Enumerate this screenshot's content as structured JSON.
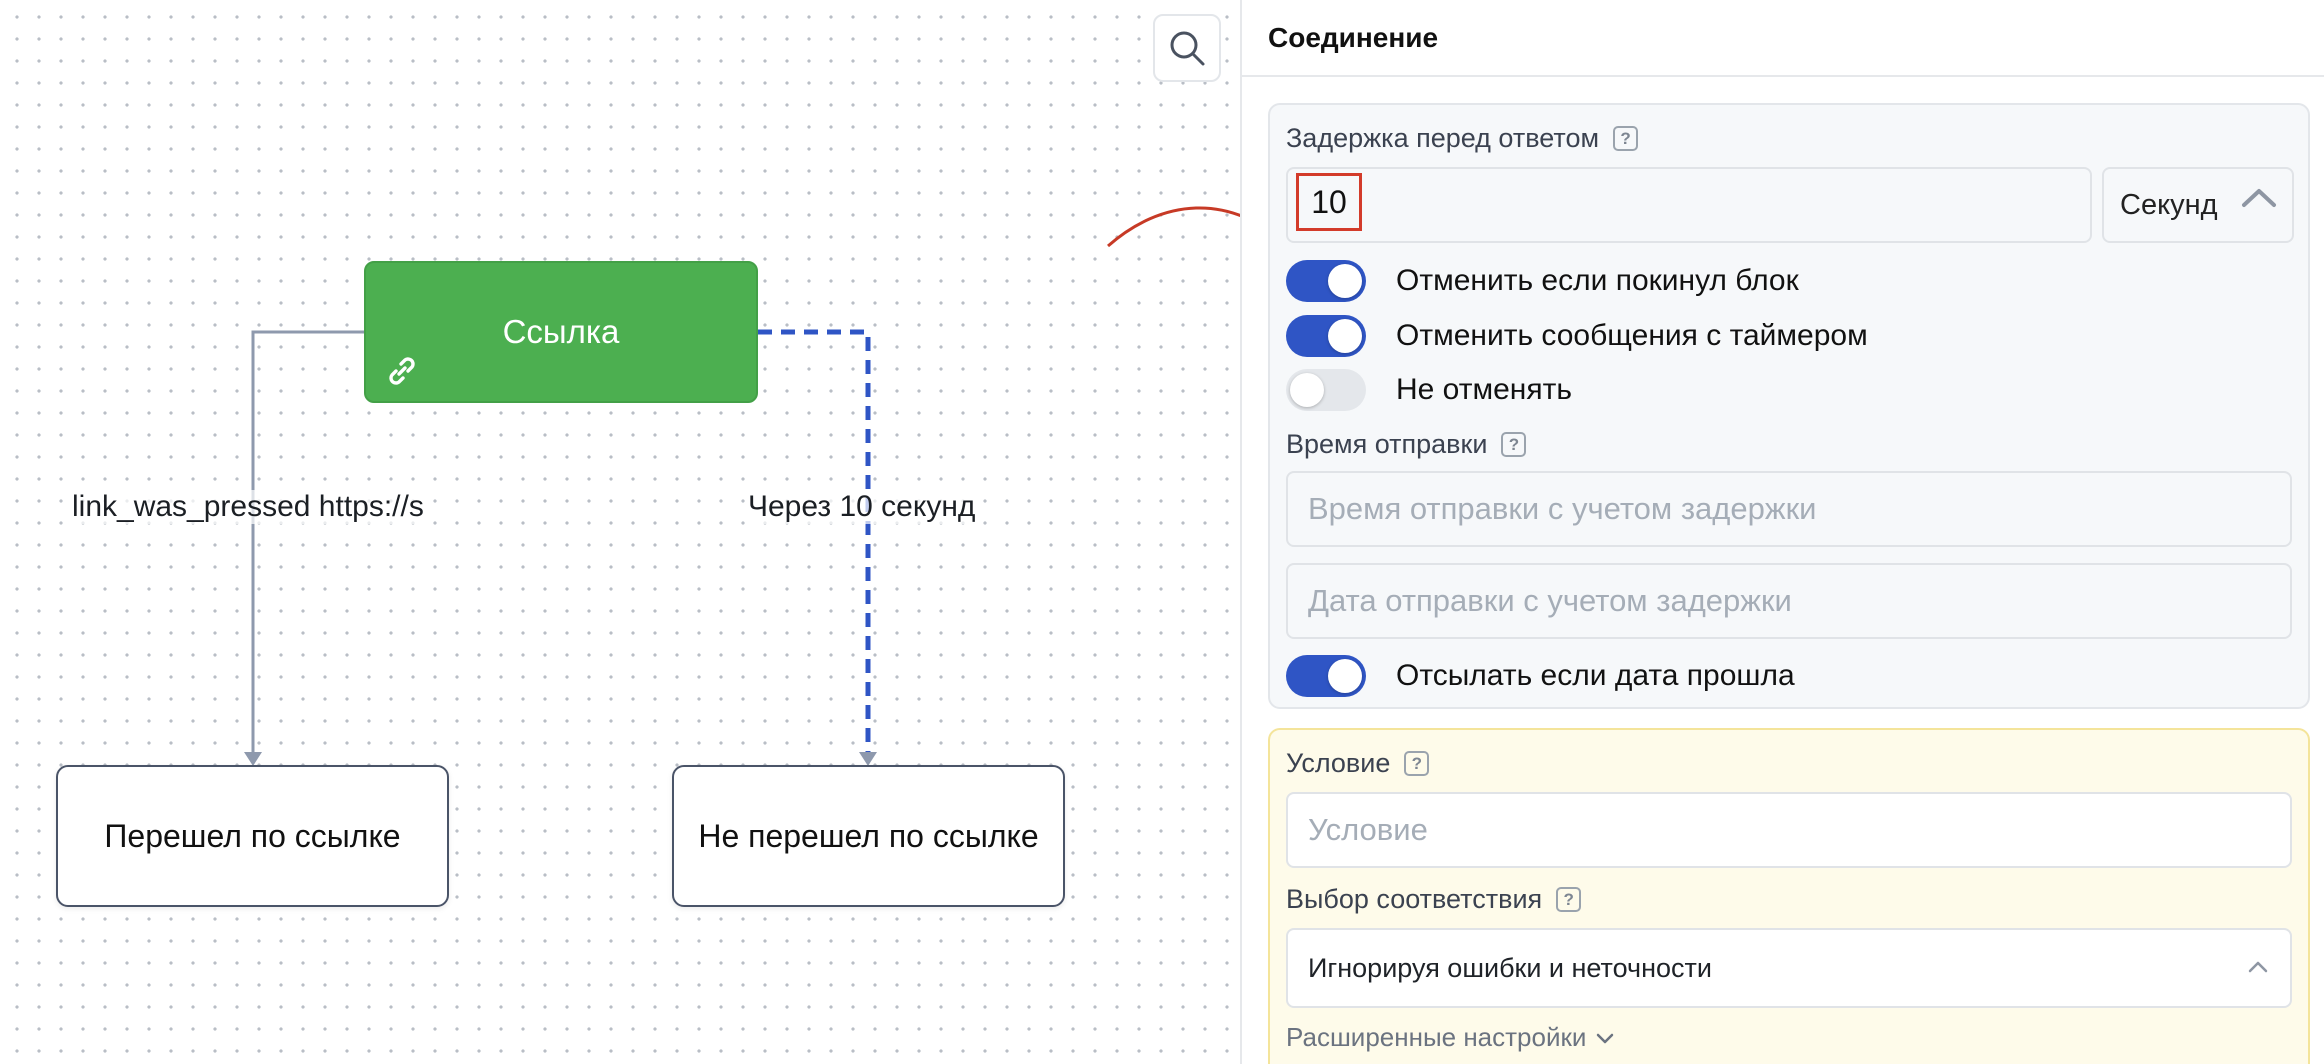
{
  "canvas": {
    "nodes": {
      "link": {
        "label": "Ссылка"
      },
      "clicked": {
        "label": "Перешел по ссылке"
      },
      "not_clicked": {
        "label": "Не перешел по ссылке"
      }
    },
    "edge_labels": {
      "left": "link_was_pressed https://s",
      "right": "Через 10 секунд"
    },
    "search_icon": "search-icon",
    "link_icon": "link-icon"
  },
  "panel": {
    "title": "Соединение",
    "delay": {
      "label": "Задержка перед ответом",
      "value": "10",
      "unit": "Секунд"
    },
    "toggles": {
      "cancel_if_left": {
        "label": "Отменить если покинул блок",
        "on": true
      },
      "cancel_timer_messages": {
        "label": "Отменить сообщения с таймером",
        "on": true
      },
      "no_cancel": {
        "label": "Не отменять",
        "on": false
      }
    },
    "send_time": {
      "label": "Время отправки",
      "time_placeholder": "Время отправки с учетом задержки",
      "date_placeholder": "Дата отправки с учетом задержки"
    },
    "send_if_date_passed": {
      "label": "Отсылать если дата прошла",
      "on": true
    },
    "condition": {
      "label": "Условие",
      "placeholder": "Условие"
    },
    "match": {
      "label": "Выбор соответствия",
      "value": "Игнорируя ошибки и неточности"
    },
    "advanced_label": "Расширенные настройки"
  },
  "colors": {
    "node_green": "#4caf50",
    "toggle_on": "#2f55c5",
    "highlight_red": "#d33b2a",
    "condition_bg": "#fefbea"
  }
}
